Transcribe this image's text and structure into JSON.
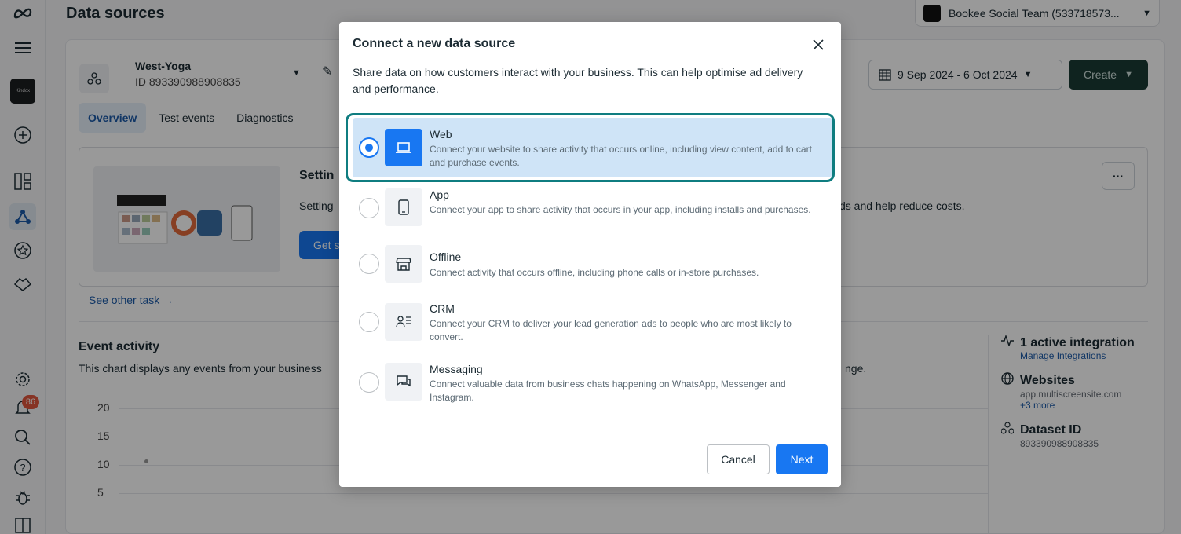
{
  "app": {
    "page_title": "Data sources",
    "account_name": "Bookee Social Team (533718573..."
  },
  "rail": {
    "notification_count": "86",
    "biz_logo_text": "Kindox"
  },
  "dataset": {
    "name": "West-Yoga",
    "id": "ID 893390988908835"
  },
  "toolbar": {
    "date_range": "9 Sep 2024 - 6 Oct 2024",
    "create_label": "Create"
  },
  "tabs": [
    {
      "label": "Overview"
    },
    {
      "label": "Test events"
    },
    {
      "label": "Diagnostics"
    }
  ],
  "setup": {
    "title": "Settin",
    "text": "Setting",
    "text_right": "ds and help reduce costs.",
    "button_label": "Get s",
    "more_label": "···"
  },
  "other_task": "See other task →",
  "events": {
    "title": "Event activity",
    "description": "This chart displays any events from your business",
    "description_right": "nge.",
    "y_ticks": [
      "20",
      "15",
      "10",
      "5"
    ]
  },
  "side": {
    "integration_title": "1 active integration",
    "integration_link": "Manage Integrations",
    "websites_title": "Websites",
    "websites_domain": "app.multiscreensite.com",
    "websites_more": "+3 more",
    "dataset_title": "Dataset ID",
    "dataset_value": "893390988908835"
  },
  "modal": {
    "title": "Connect a new data source",
    "description": "Share data on how customers interact with your business. This can help optimise ad delivery and performance.",
    "options": [
      {
        "title": "Web",
        "description": "Connect your website to share activity that occurs online, including view content, add to cart and purchase events.",
        "icon": "laptop-icon",
        "selected": true
      },
      {
        "title": "App",
        "description": "Connect your app to share activity that occurs in your app, including installs and purchases.",
        "icon": "phone-icon",
        "selected": false
      },
      {
        "title": "Offline",
        "description": "Connect activity that occurs offline, including phone calls or in-store purchases.",
        "icon": "store-icon",
        "selected": false
      },
      {
        "title": "CRM",
        "description": "Connect your CRM to deliver your lead generation ads to people who are most likely to convert.",
        "icon": "people-icon",
        "selected": false
      },
      {
        "title": "Messaging",
        "description": "Connect valuable data from business chats happening on WhatsApp, Messenger and Instagram.",
        "icon": "chat-icon",
        "selected": false
      }
    ],
    "cancel_label": "Cancel",
    "next_label": "Next"
  },
  "colors": {
    "primary": "#1877f2",
    "selected_bg": "#cfe4f7",
    "focus_ring": "#0f7d80",
    "create_btn": "#1a3b34"
  }
}
